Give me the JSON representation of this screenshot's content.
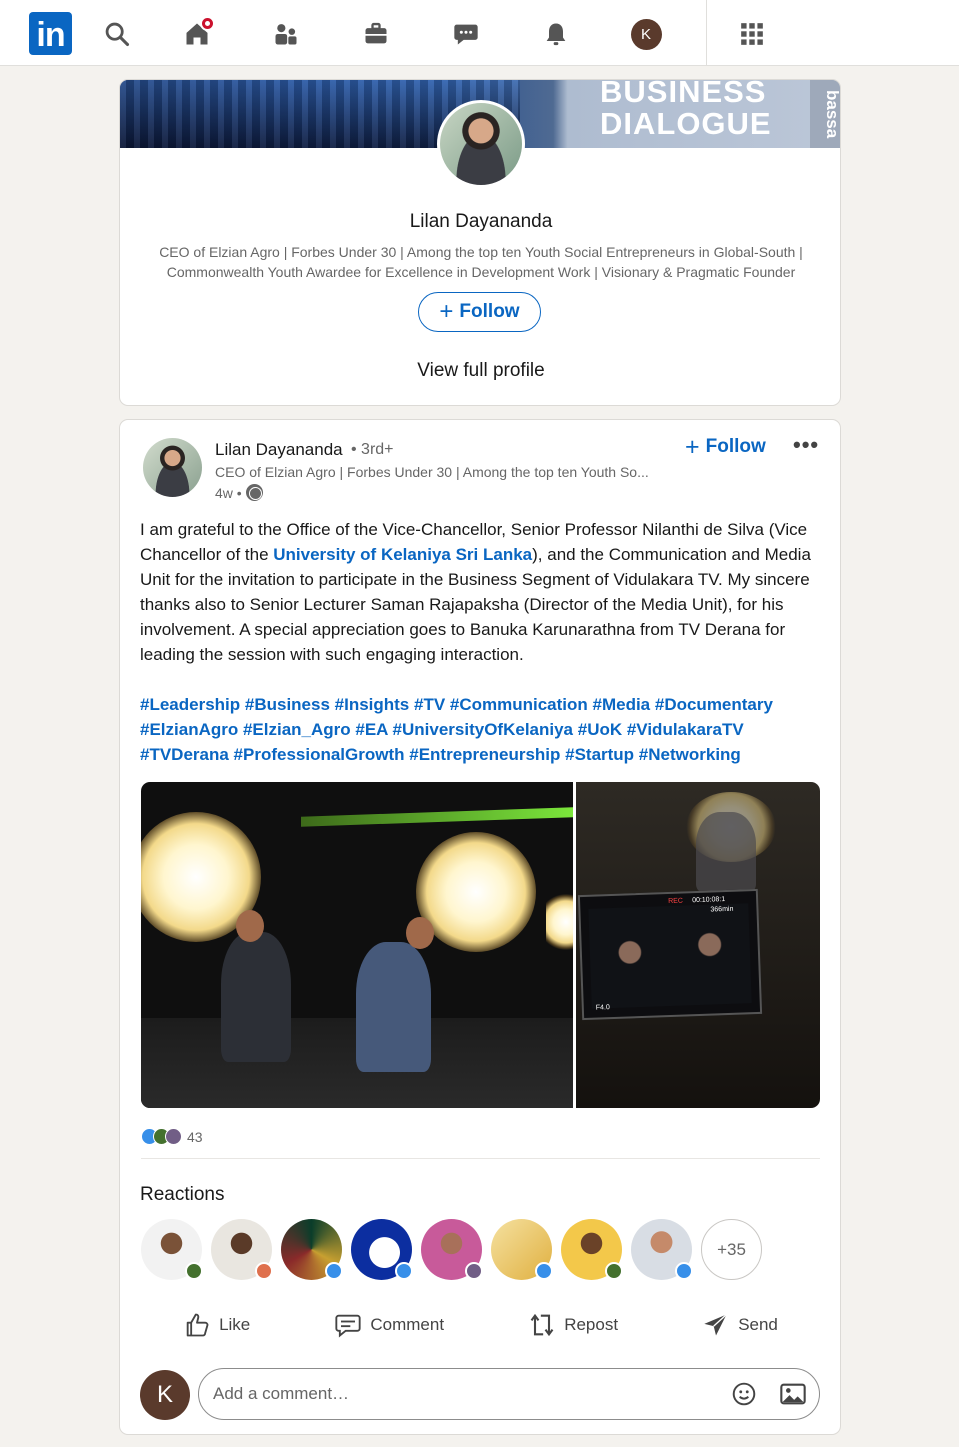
{
  "nav": {
    "logo_text": "in",
    "icons": [
      "search-icon",
      "home-icon",
      "network-icon",
      "jobs-icon",
      "messaging-icon",
      "notifications-icon",
      "me-avatar",
      "apps-grid-icon"
    ],
    "me_initial": "K",
    "home_has_badge": true
  },
  "profile_card": {
    "banner_text_line1": "BUSINESS",
    "banner_text_line2": "DIALOGUE",
    "banner_side_text": "bassa",
    "name": "Lilan Dayananda",
    "headline_line1": "CEO of Elzian Agro | Forbes Under 30 | Among the top ten Youth Social Entrepreneurs in Global-South |",
    "headline_line2": "Commonwealth Youth Awardee for Excellence in Development Work | Visionary & Pragmatic Founder",
    "follow_label": "Follow",
    "view_profile_label": "View full profile"
  },
  "post": {
    "author": "Lilan Dayananda",
    "degree": "• 3rd+",
    "headline": "CEO of Elzian Agro | Forbes Under 30 | Among the top ten Youth So...",
    "time": "4w •",
    "follow_label": "Follow",
    "more_label": "•••",
    "body_part1": "I am grateful to the Office of the Vice-Chancellor, Senior Professor Nilanthi de Silva (Vice Chancellor of the ",
    "body_link": "University of Kelaniya Sri Lanka",
    "body_part2": "), and the Communication and Media Unit for the invitation to participate in the Business Segment of Vidulakara TV. My sincere thanks also to Senior Lecturer Saman Rajapaksha (Director of the Media Unit), for his involvement. A special appreciation goes to Banuka Karunarathna from TV Derana for leading the session with such engaging interaction.",
    "hashtags_line1": "#Leadership #Business #Insights #TV #Communication #Media #Documentary",
    "hashtags_line2": "#ElzianAgro #Elzian_Agro #EA #UniversityOfKelaniya #UoK #VidulakaraTV",
    "hashtags_line3": "#TVDerana #ProfessionalGrowth #Entrepreneurship #Startup #Networking",
    "camera_text": {
      "rec": "REC",
      "timecode": "00:10:08:1",
      "remaining": "366min",
      "fstop": "F4.0"
    },
    "reaction_count": "43",
    "reactions_title": "Reactions",
    "more_reactors": "+35",
    "actions": {
      "like": "Like",
      "comment": "Comment",
      "repost": "Repost",
      "send": "Send"
    },
    "commenter_initial": "K",
    "comment_placeholder": "Add a comment…"
  },
  "colors": {
    "brand": "#0a66c2",
    "background": "#f4f2ee",
    "notification": "#cb112d"
  }
}
